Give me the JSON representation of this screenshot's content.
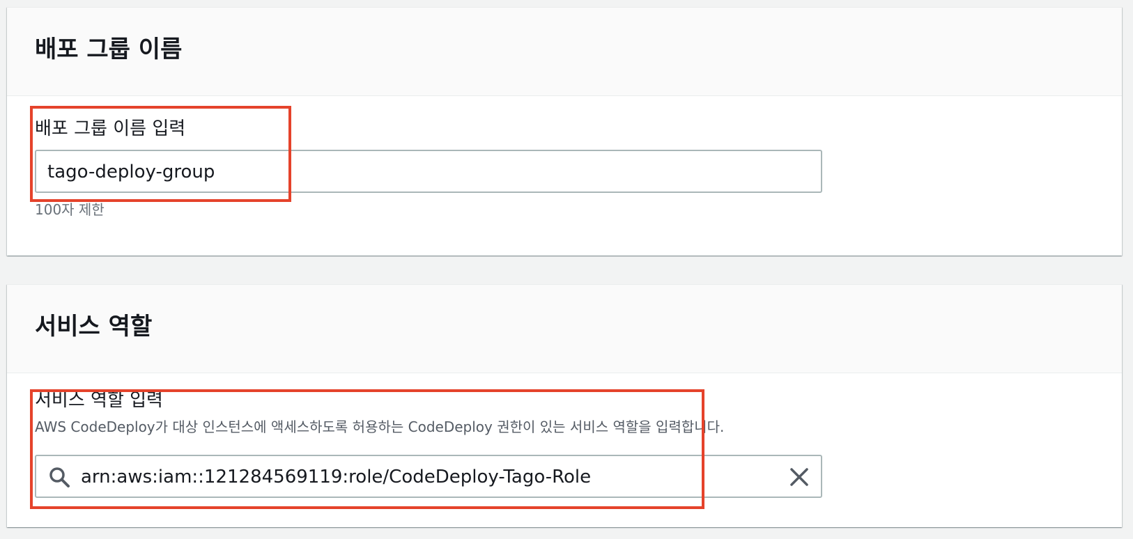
{
  "deployment_group": {
    "title": "배포 그룹 이름",
    "field_label": "배포 그룹 이름 입력",
    "input_value": "tago-deploy-group",
    "constraint_text": "100자 제한"
  },
  "service_role": {
    "title": "서비스 역할",
    "field_label": "서비스 역할 입력",
    "description": "AWS CodeDeploy가 대상 인스턴스에 액세스하도록 허용하는 CodeDeploy 권한이 있는 서비스 역할을 입력합니다.",
    "input_value": "arn:aws:iam::121284569119:role/CodeDeploy-Tago-Role",
    "search_icon": "search-icon",
    "clear_icon": "close-icon"
  },
  "colors": {
    "highlight": "#e5432b",
    "page_background": "#f2f3f3",
    "panel_header": "#fafafa",
    "input_border": "#aab7b8",
    "description_text": "#545b64"
  }
}
